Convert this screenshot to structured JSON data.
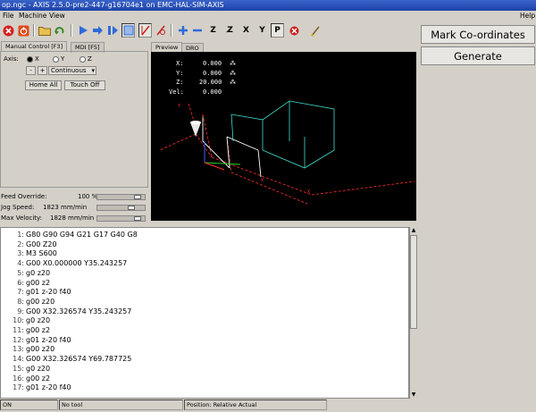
{
  "window": {
    "title": "op.ngc - AXIS 2.5.0-pre2-447-g16704e1 on EMC-HAL-SIM-AXIS"
  },
  "menu": {
    "file": "File",
    "machine": "Machine",
    "view": "View",
    "help": "Help"
  },
  "right_panel": {
    "mark_label": "Mark Co-ordinates",
    "generate_label": "Generate"
  },
  "tabs": {
    "manual": "Manual Control [F3]",
    "mdi": "MDI [F5]",
    "preview": "Preview",
    "dro": "DRO"
  },
  "manual": {
    "axis_label": "Axis:",
    "axes": [
      "X",
      "Y",
      "Z"
    ],
    "minus": "-",
    "plus": "+",
    "jog_mode": "Continuous",
    "home_all": "Home All",
    "touch_off": "Touch Off"
  },
  "overrides": {
    "feed_label": "Feed Override:",
    "feed_value": "100 %",
    "feed_level": 0.9,
    "jog_label": "Jog Speed:",
    "jog_value": "1823 mm/min",
    "jog_level": 0.75,
    "vel_label": "Max Velocity:",
    "vel_value": "1828 mm/min",
    "vel_level": 0.9
  },
  "dro": [
    {
      "label": "X:",
      "value": "0.000"
    },
    {
      "label": "Y:",
      "value": "0.000"
    },
    {
      "label": "Z:",
      "value": "20.000"
    },
    {
      "label": "Vel:",
      "value": "0.000"
    }
  ],
  "gcode": [
    {
      "n": "1:",
      "t": "G80 G90 G94 G21 G17 G40 G8"
    },
    {
      "n": "2:",
      "t": "G00 Z20"
    },
    {
      "n": "3:",
      "t": "M3 S600"
    },
    {
      "n": "4:",
      "t": "G00 X0.000000 Y35.243257"
    },
    {
      "n": "5:",
      "t": "g0 z20"
    },
    {
      "n": "6:",
      "t": "g00 z2"
    },
    {
      "n": "7:",
      "t": "g01 z-20 f40"
    },
    {
      "n": "8:",
      "t": "g00 z20"
    },
    {
      "n": "9:",
      "t": "G00 X32.326574 Y35.243257"
    },
    {
      "n": "10:",
      "t": "g0 z20"
    },
    {
      "n": "11:",
      "t": "g00 z2"
    },
    {
      "n": "12:",
      "t": "g01 z-20 f40"
    },
    {
      "n": "13:",
      "t": "g00 z20"
    },
    {
      "n": "14:",
      "t": "G00 X32.326574 Y69.787725"
    },
    {
      "n": "15:",
      "t": "g0 z20"
    },
    {
      "n": "16:",
      "t": "g00 z2"
    },
    {
      "n": "17:",
      "t": "g01 z-20 f40"
    }
  ],
  "status": {
    "state": "ON",
    "tool": "No tool",
    "position": "Position: Relative Actual"
  },
  "colors": {
    "title_bg": "#2a52be",
    "preview_bg": "#000000",
    "rapid": "#ff3030",
    "feed": "#ffffff",
    "box": "#40e0d0"
  }
}
